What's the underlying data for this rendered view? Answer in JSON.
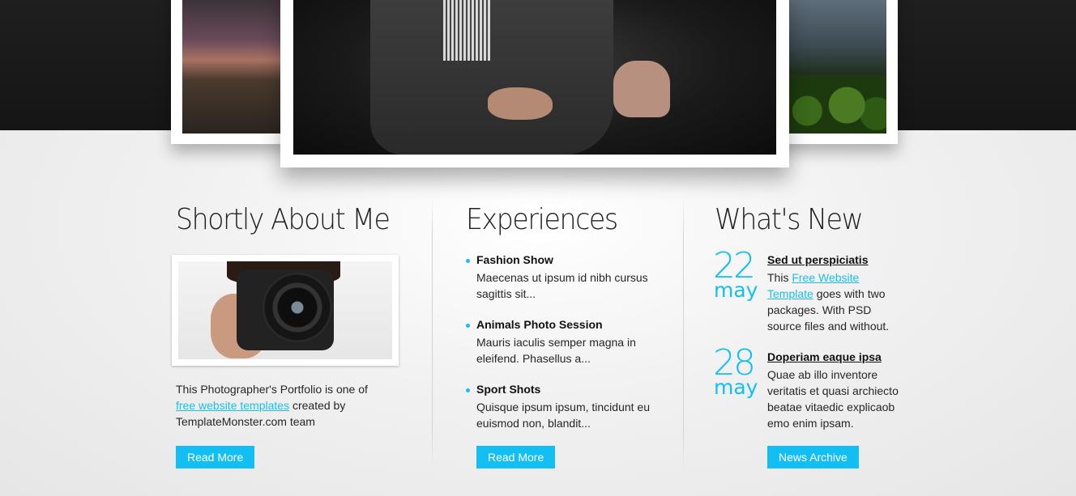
{
  "about": {
    "heading": "Shortly About Me",
    "text_before": "This Photographer's Portfolio is one of",
    "link": "free website templates",
    "text_after": " created by TemplateMonster.com team",
    "button": "Read More"
  },
  "experiences": {
    "heading": "Experiences",
    "items": [
      {
        "title": "Fashion Show",
        "text": "Maecenas ut ipsum id nibh cursus sagittis sit..."
      },
      {
        "title": "Animals Photo Session",
        "text": "Mauris iaculis semper magna in eleifend. Phasellus a..."
      },
      {
        "title": "Sport Shots",
        "text": "Quisque ipsum ipsum, tincidunt eu euismod non, blandit..."
      }
    ],
    "button": "Read More"
  },
  "news": {
    "heading": "What's New",
    "items": [
      {
        "day": "22",
        "month": "may",
        "title": "Sed ut perspiciatis",
        "text_before": "This ",
        "link": "Free Website Template",
        "text_after": " goes with two packages. With PSD source files and without."
      },
      {
        "day": "28",
        "month": "may",
        "title": "Doperiam eaque ipsa ",
        "text": "Quae ab illo inventore veritatis et quasi archiecto beatae vitaedic explicaob emo enim ipsam."
      }
    ],
    "button": "News Archive"
  },
  "colors": {
    "accent": "#13bff2",
    "top_band": "#1a1a1a"
  }
}
